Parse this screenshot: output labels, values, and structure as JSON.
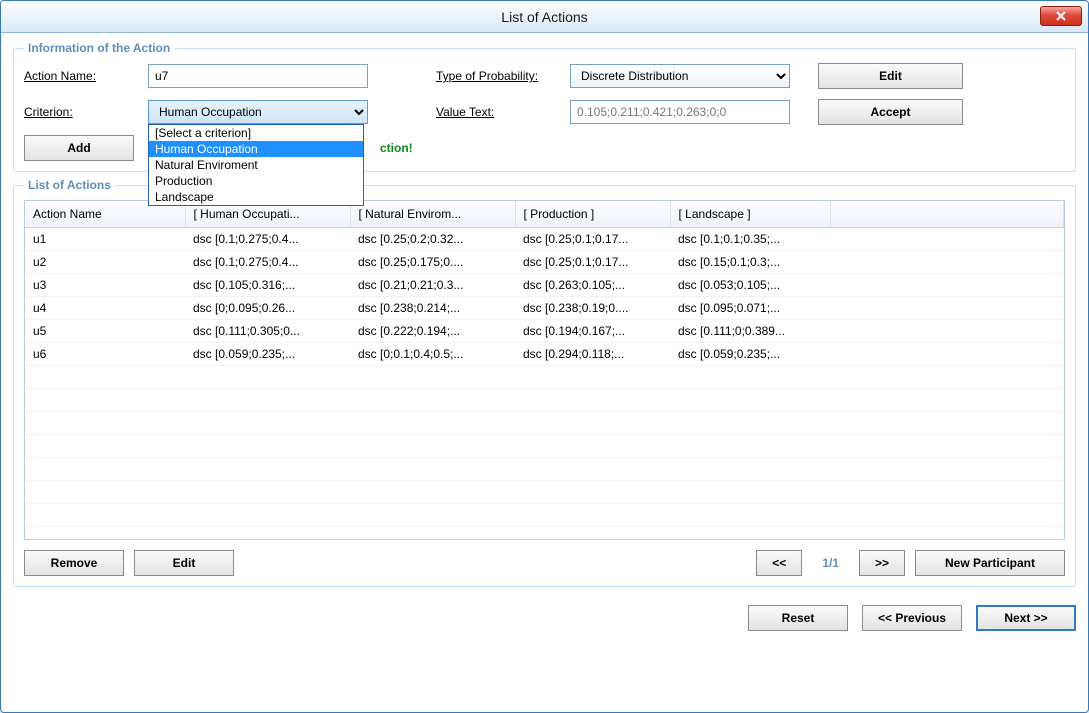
{
  "window": {
    "title": "List of Actions"
  },
  "info": {
    "legend": "Information of the Action",
    "actionNameLabel": "Action Name:",
    "actionNameValue": "u7",
    "criterionLabel": "Criterion:",
    "criterionSelected": "Human Occupation",
    "criterionOptions": [
      "[Select a criterion]",
      "Human Occupation",
      "Natural Enviroment",
      "Production",
      "Landscape"
    ],
    "criterionSelectedIndex": 1,
    "typeProbLabel": "Type of Probability:",
    "typeProbSelected": "Discrete Distribution",
    "valueTextLabel": "Value Text:",
    "valueTextValue": "0.105;0.211;0.421;0.263;0;0",
    "editLabel": "Edit",
    "acceptLabel": "Accept",
    "addLabel": "Add",
    "successMsg": "ction!"
  },
  "list": {
    "legend": "List of Actions",
    "headers": [
      "Action Name",
      "[ Human Occupati...",
      "[ Natural Envirom...",
      "[ Production ]",
      "[ Landscape ]",
      ""
    ],
    "rows": [
      [
        "u1",
        "dsc [0.1;0.275;0.4...",
        "dsc [0.25;0.2;0.32...",
        "dsc [0.25;0.1;0.17...",
        "dsc [0.1;0.1;0.35;..."
      ],
      [
        "u2",
        "dsc [0.1;0.275;0.4...",
        "dsc [0.25;0.175;0....",
        "dsc [0.25;0.1;0.17...",
        "dsc [0.15;0.1;0.3;..."
      ],
      [
        "u3",
        "dsc [0.105;0.316;...",
        "dsc [0.21;0.21;0.3...",
        "dsc [0.263;0.105;...",
        "dsc [0.053;0.105;..."
      ],
      [
        "u4",
        "dsc [0;0.095;0.26...",
        "dsc [0.238;0.214;...",
        "dsc [0.238;0.19;0....",
        "dsc [0.095;0.071;..."
      ],
      [
        "u5",
        "dsc [0.111;0.305;0...",
        "dsc [0.222;0.194;...",
        "dsc [0.194;0.167;...",
        "dsc [0.111;0;0.389..."
      ],
      [
        "u6",
        "dsc [0.059;0.235;...",
        "dsc [0;0.1;0.4;0.5;...",
        "dsc [0.294;0.118;...",
        "dsc [0.059;0.235;..."
      ]
    ],
    "emptyRows": 7
  },
  "footer": {
    "remove": "Remove",
    "edit": "Edit",
    "prevPage": "<<",
    "nextPage": ">>",
    "pageText": "1/1",
    "newParticipant": "New Participant",
    "reset": "Reset",
    "previous": "<< Previous",
    "next": "Next >>"
  }
}
